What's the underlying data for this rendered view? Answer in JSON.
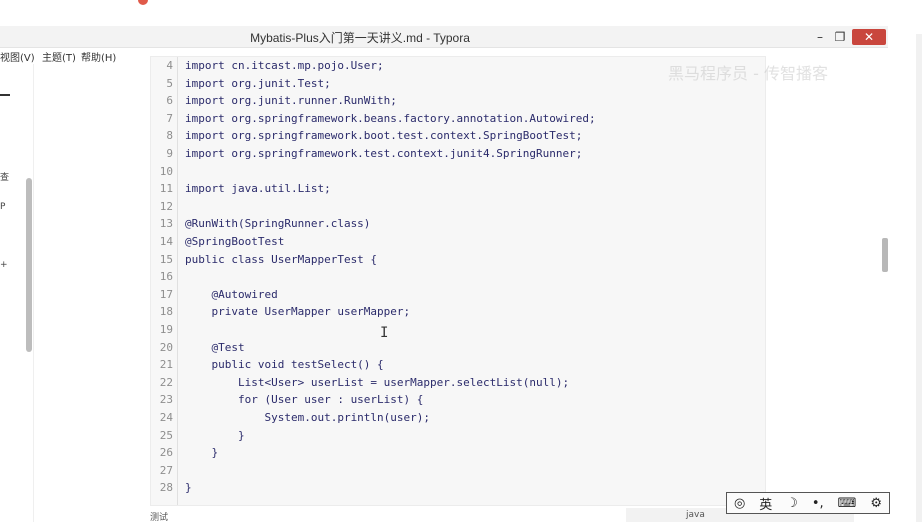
{
  "window": {
    "title": "Mybatis-Plus入门第一天讲义.md - Typora",
    "min_glyph": "–",
    "max_glyph": "❐",
    "close_glyph": "✕"
  },
  "menu": {
    "view": "视图(V)",
    "theme": "主题(T)",
    "help": "帮助(H)"
  },
  "sidebar": {
    "labels": [
      "查",
      "P",
      "+"
    ]
  },
  "code": {
    "lines": [
      {
        "n": "4",
        "t": "import cn.itcast.mp.pojo.User;"
      },
      {
        "n": "5",
        "t": "import org.junit.Test;"
      },
      {
        "n": "6",
        "t": "import org.junit.runner.RunWith;"
      },
      {
        "n": "7",
        "t": "import org.springframework.beans.factory.annotation.Autowired;"
      },
      {
        "n": "8",
        "t": "import org.springframework.boot.test.context.SpringBootTest;"
      },
      {
        "n": "9",
        "t": "import org.springframework.test.context.junit4.SpringRunner;"
      },
      {
        "n": "10",
        "t": ""
      },
      {
        "n": "11",
        "t": "import java.util.List;"
      },
      {
        "n": "12",
        "t": ""
      },
      {
        "n": "13",
        "t": "@RunWith(SpringRunner.class)"
      },
      {
        "n": "14",
        "t": "@SpringBootTest"
      },
      {
        "n": "15",
        "t": "public class UserMapperTest {"
      },
      {
        "n": "16",
        "t": ""
      },
      {
        "n": "17",
        "t": "    @Autowired"
      },
      {
        "n": "18",
        "t": "    private UserMapper userMapper;"
      },
      {
        "n": "19",
        "t": ""
      },
      {
        "n": "20",
        "t": "    @Test"
      },
      {
        "n": "21",
        "t": "    public void testSelect() {"
      },
      {
        "n": "22",
        "t": "        List<User> userList = userMapper.selectList(null);"
      },
      {
        "n": "23",
        "t": "        for (User user : userList) {"
      },
      {
        "n": "24",
        "t": "            System.out.println(user);"
      },
      {
        "n": "25",
        "t": "        }"
      },
      {
        "n": "26",
        "t": "    }"
      },
      {
        "n": "27",
        "t": ""
      },
      {
        "n": "28",
        "t": "}"
      }
    ],
    "language": "java"
  },
  "watermark": "黑马程序员 - 传智播客",
  "footer": {
    "word": "测试"
  },
  "ime": {
    "lang": "英",
    "moon": "☽",
    "punct": "•,",
    "keyboard": "⌨",
    "gear": "⚙"
  },
  "colors": {
    "close_button": "#c9463d",
    "code_bg": "#f7f7f7",
    "code_text": "#2b2b6b"
  }
}
